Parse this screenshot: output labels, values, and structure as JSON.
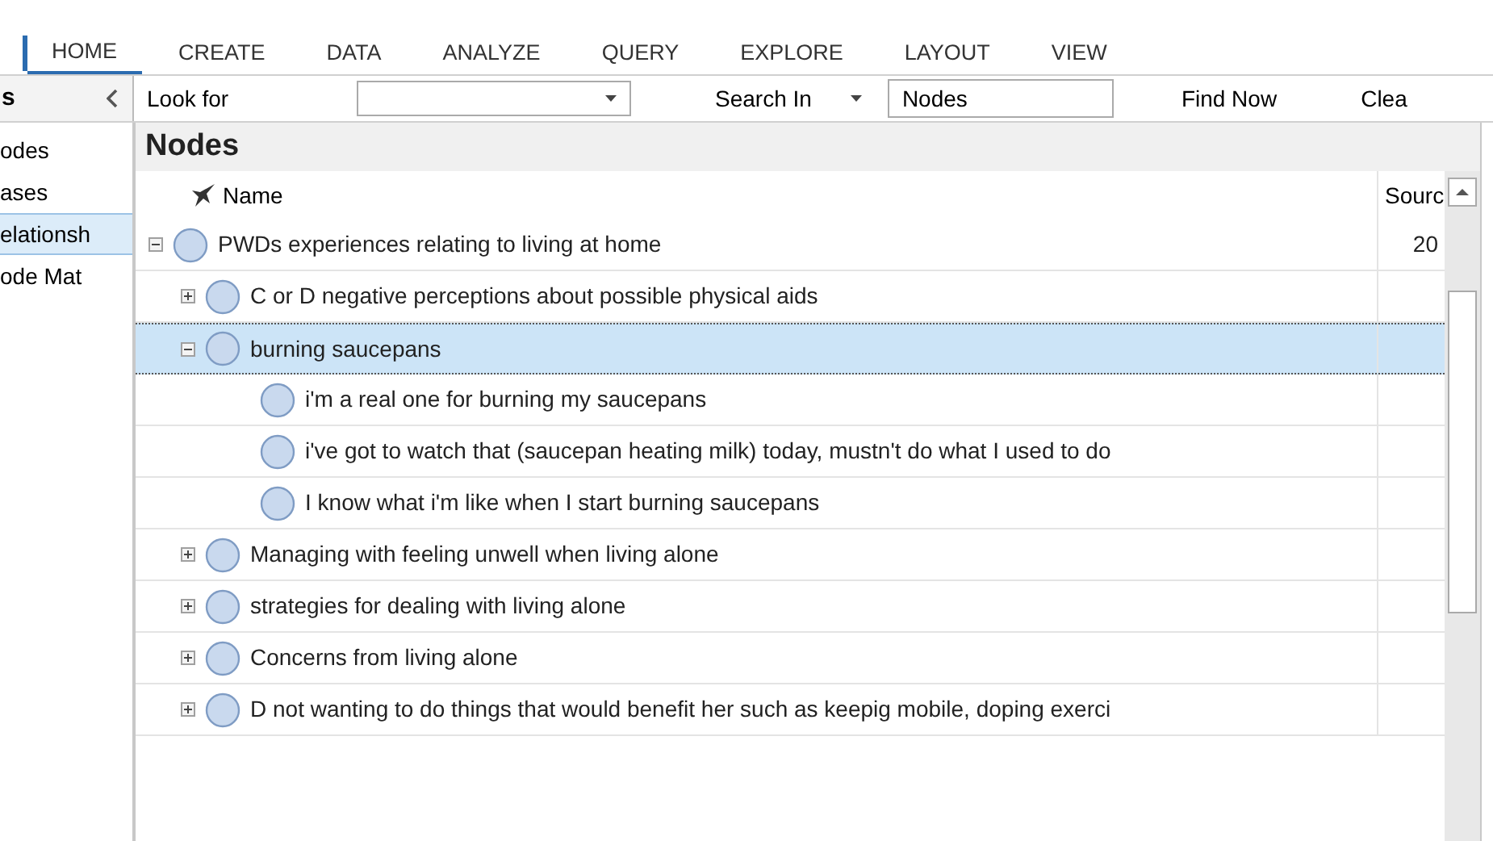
{
  "ribbon_tabs": [
    {
      "label": "HOME",
      "selected": true
    },
    {
      "label": "CREATE",
      "selected": false
    },
    {
      "label": "DATA",
      "selected": false
    },
    {
      "label": "ANALYZE",
      "selected": false
    },
    {
      "label": "QUERY",
      "selected": false
    },
    {
      "label": "EXPLORE",
      "selected": false
    },
    {
      "label": "LAYOUT",
      "selected": false
    },
    {
      "label": "VIEW",
      "selected": false
    }
  ],
  "sidebar": {
    "header": "s",
    "items": [
      {
        "label": "odes",
        "selected": false
      },
      {
        "label": "ases",
        "selected": false
      },
      {
        "label": "elationsh",
        "selected": true
      },
      {
        "label": "ode Mat",
        "selected": false
      }
    ]
  },
  "find_bar": {
    "look_for_label": "Look for",
    "search_in_label": "Search In",
    "search_in_value": "Nodes",
    "find_now": "Find Now",
    "clear": "Clea"
  },
  "panel": {
    "title": "Nodes",
    "columns": [
      "Name",
      "Sourc"
    ],
    "rows": [
      {
        "name": "PWDs experiences relating to living at home",
        "source": "20",
        "expanded": true,
        "selected": false,
        "children": [
          {
            "name": "C or D negative perceptions about possible physical aids",
            "expanded": false,
            "selected": false
          },
          {
            "name": "burning saucepans",
            "expanded": true,
            "selected": true,
            "children": [
              {
                "name": "i'm a real one for burning my saucepans",
                "selected": false
              },
              {
                "name": "i've got to watch that (saucepan heating milk) today, mustn't do what I used to do",
                "selected": false
              },
              {
                "name": "I know what i'm like when I start burning saucepans",
                "selected": false
              }
            ]
          },
          {
            "name": "Managing with feeling unwell when living alone",
            "expanded": false,
            "selected": false
          },
          {
            "name": "strategies for dealing with living alone",
            "expanded": false,
            "selected": false
          },
          {
            "name": "Concerns from living alone",
            "expanded": false,
            "selected": false
          },
          {
            "name": "D not wanting to do things that would benefit her such as keepig mobile, doping exerci",
            "expanded": false,
            "selected": false
          }
        ]
      }
    ]
  }
}
